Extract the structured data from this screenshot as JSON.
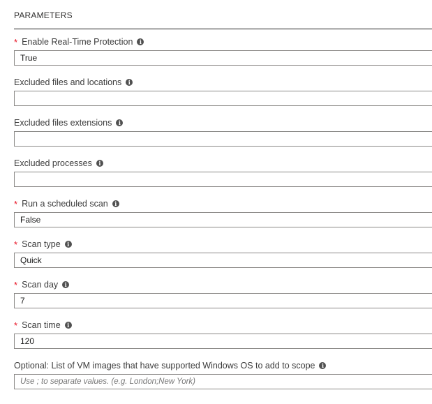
{
  "section_title": "PARAMETERS",
  "fields": [
    {
      "label": "Enable Real-Time Protection",
      "required": true,
      "value": "True"
    },
    {
      "label": "Excluded files and locations",
      "required": false,
      "value": ""
    },
    {
      "label": "Excluded files extensions",
      "required": false,
      "value": ""
    },
    {
      "label": "Excluded processes",
      "required": false,
      "value": ""
    },
    {
      "label": "Run a scheduled scan",
      "required": true,
      "value": "False"
    },
    {
      "label": "Scan type",
      "required": true,
      "value": "Quick"
    },
    {
      "label": "Scan day",
      "required": true,
      "value": "7"
    },
    {
      "label": "Scan time",
      "required": true,
      "value": "120"
    },
    {
      "label": "Optional: List of VM images that have supported Windows OS to add to scope",
      "required": false,
      "value": "",
      "placeholder": "Use ; to separate values. (e.g. London;New York)"
    }
  ],
  "required_marker": "*",
  "info_glyph": "i"
}
